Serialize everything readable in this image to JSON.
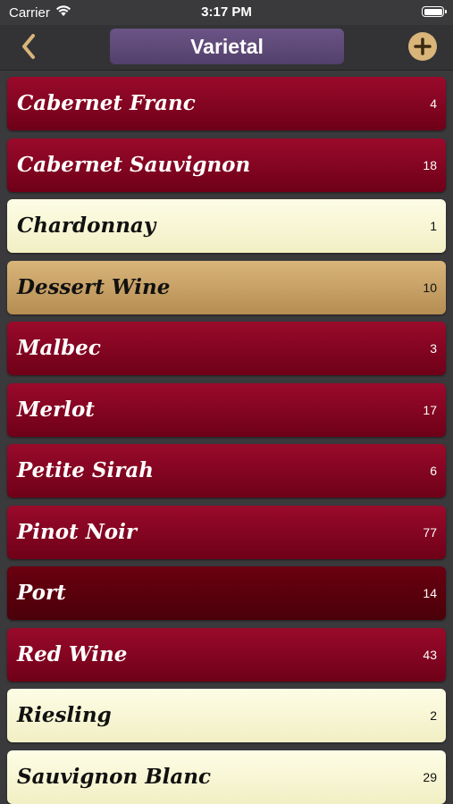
{
  "status_bar": {
    "carrier": "Carrier",
    "time": "3:17 PM"
  },
  "nav": {
    "title": "Varietal",
    "back_icon": "chevron-left-icon",
    "add_icon": "plus-circle-icon",
    "accent_color": "#d9b57a",
    "title_color": "#5f4a79"
  },
  "varietals": [
    {
      "name": "Cabernet Franc",
      "count": "4",
      "style": "red"
    },
    {
      "name": "Cabernet Sauvignon",
      "count": "18",
      "style": "red"
    },
    {
      "name": "Chardonnay",
      "count": "1",
      "style": "white"
    },
    {
      "name": "Dessert Wine",
      "count": "10",
      "style": "dessert"
    },
    {
      "name": "Malbec",
      "count": "3",
      "style": "red"
    },
    {
      "name": "Merlot",
      "count": "17",
      "style": "red"
    },
    {
      "name": "Petite Sirah",
      "count": "6",
      "style": "red"
    },
    {
      "name": "Pinot Noir",
      "count": "77",
      "style": "red"
    },
    {
      "name": "Port",
      "count": "14",
      "style": "dark"
    },
    {
      "name": "Red Wine",
      "count": "43",
      "style": "red"
    },
    {
      "name": "Riesling",
      "count": "2",
      "style": "white"
    },
    {
      "name": "Sauvignon Blanc",
      "count": "29",
      "style": "white"
    }
  ]
}
